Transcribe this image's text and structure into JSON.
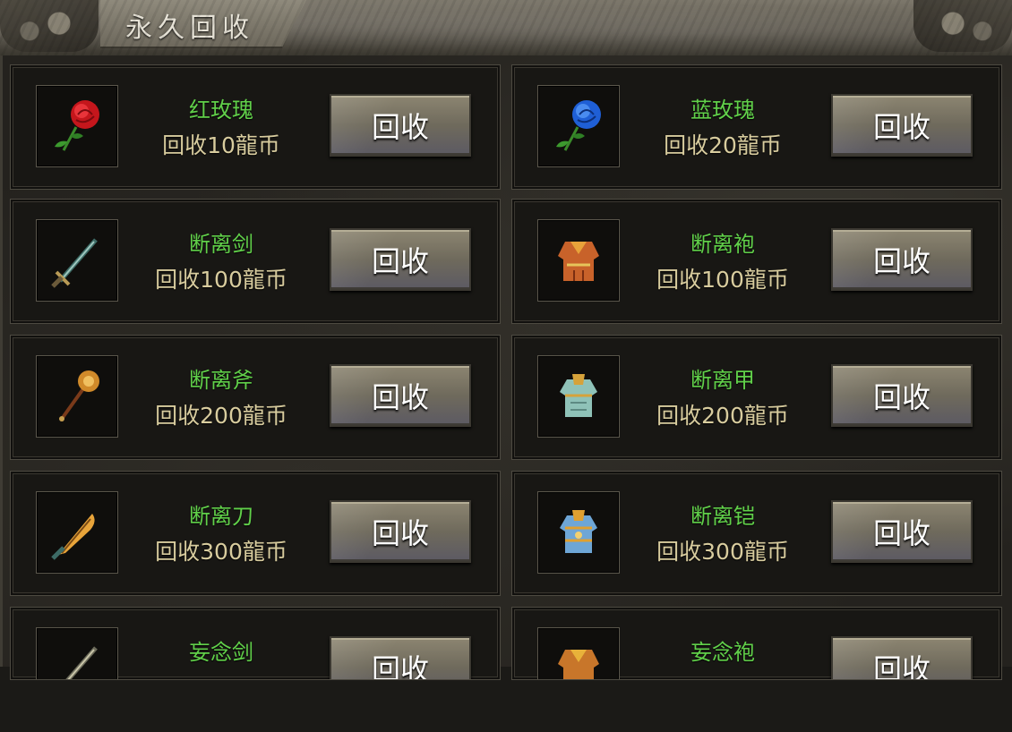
{
  "header": {
    "title": "永久回收"
  },
  "items": [
    {
      "name": "红玫瑰",
      "price": "回收10龍币",
      "button": "回收",
      "icon": "red-rose-icon"
    },
    {
      "name": "蓝玫瑰",
      "price": "回收20龍币",
      "button": "回收",
      "icon": "blue-rose-icon"
    },
    {
      "name": "断离剑",
      "price": "回收100龍币",
      "button": "回收",
      "icon": "sword-icon"
    },
    {
      "name": "断离袍",
      "price": "回收100龍币",
      "button": "回收",
      "icon": "robe-icon"
    },
    {
      "name": "断离斧",
      "price": "回收200龍币",
      "button": "回收",
      "icon": "axe-icon"
    },
    {
      "name": "断离甲",
      "price": "回收200龍币",
      "button": "回收",
      "icon": "armor-icon"
    },
    {
      "name": "断离刀",
      "price": "回收300龍币",
      "button": "回收",
      "icon": "blade-icon"
    },
    {
      "name": "断离铠",
      "price": "回收300龍币",
      "button": "回收",
      "icon": "plate-armor-icon"
    },
    {
      "name": "妄念剑",
      "price": "",
      "button": "回收",
      "icon": "sword-icon"
    },
    {
      "name": "妄念袍",
      "price": "",
      "button": "回收",
      "icon": "robe-icon"
    }
  ]
}
